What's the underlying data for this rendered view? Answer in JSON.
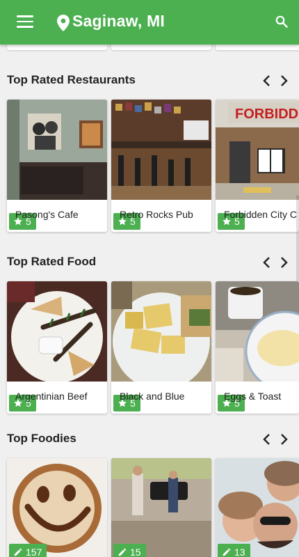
{
  "appbar": {
    "location": "Saginaw, MI",
    "menu_icon": "menu-icon",
    "location_icon": "location-pin-icon",
    "search_icon": "search-icon",
    "color": "#4caf50"
  },
  "sections": [
    {
      "title": "Top Rated Restaurants",
      "cards": [
        {
          "label": "Pasong's Cafe",
          "badge": "5",
          "badge_icon": "star-icon"
        },
        {
          "label": "Retro Rocks Pub",
          "badge": "5",
          "badge_icon": "star-icon"
        },
        {
          "label": "Forbidden City C",
          "badge": "5",
          "badge_icon": "star-icon"
        }
      ]
    },
    {
      "title": "Top Rated Food",
      "cards": [
        {
          "label": "Argentinian Beef",
          "badge": "5",
          "badge_icon": "star-icon"
        },
        {
          "label": "Black and Blue",
          "badge": "5",
          "badge_icon": "star-icon"
        },
        {
          "label": "Eggs & Toast",
          "badge": "5",
          "badge_icon": "star-icon"
        }
      ]
    },
    {
      "title": "Top Foodies",
      "cards": [
        {
          "badge": "157",
          "badge_icon": "pencil-icon"
        },
        {
          "badge": "15",
          "badge_icon": "pencil-icon"
        },
        {
          "badge": "13",
          "badge_icon": "pencil-icon"
        }
      ]
    }
  ],
  "restaurant_sign_text": "FORBIDD"
}
